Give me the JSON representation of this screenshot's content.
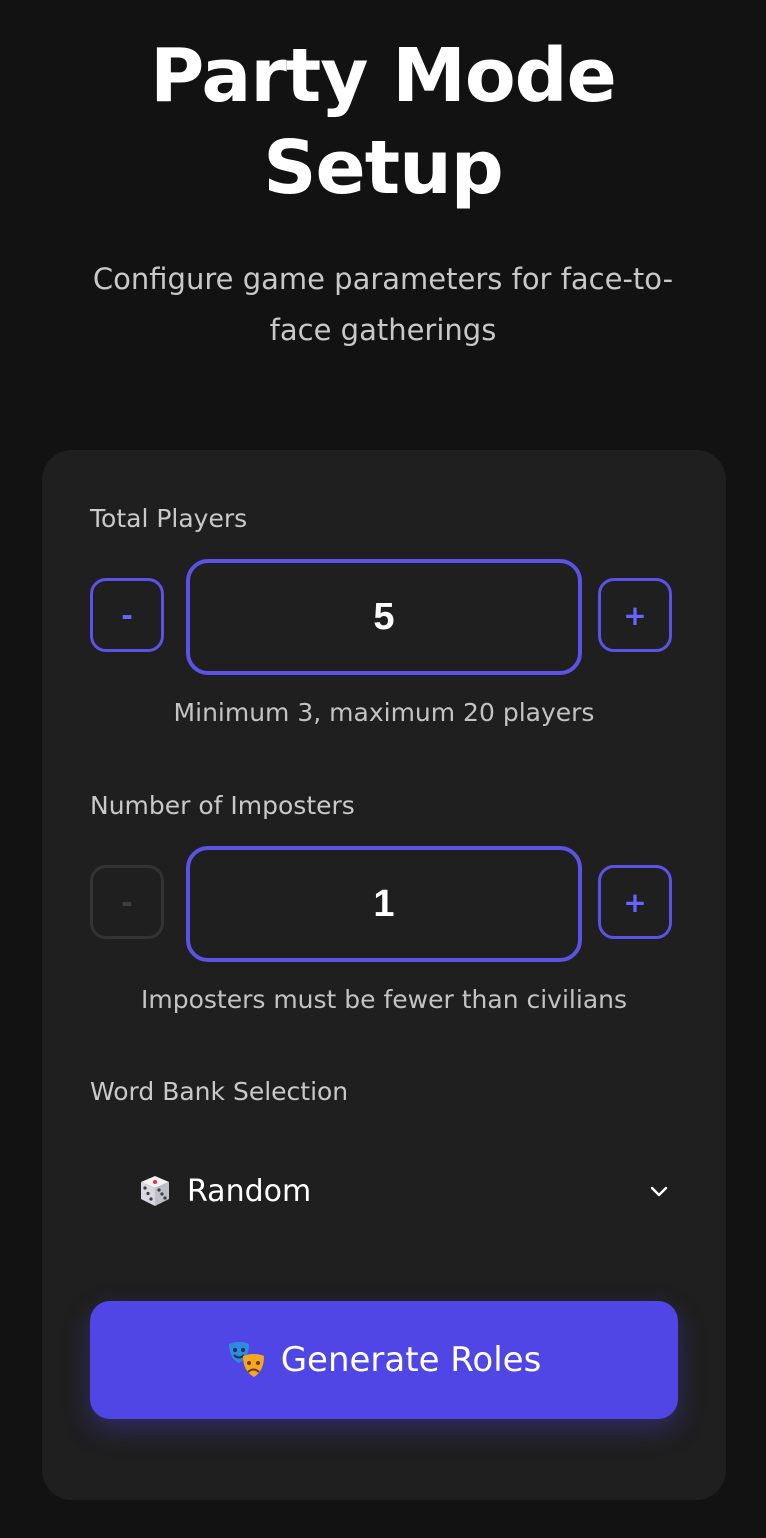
{
  "header": {
    "title_line1": "Party Mode",
    "title_line2": "Setup",
    "subtitle_line1": "Configure game parameters for face-to-",
    "subtitle_line2": "face gatherings"
  },
  "players": {
    "label": "Total Players",
    "decrement_label": "-",
    "increment_label": "+",
    "value": "5",
    "hint": "Minimum 3, maximum 20 players"
  },
  "imposters": {
    "label": "Number of Imposters",
    "decrement_label": "-",
    "increment_label": "+",
    "value": "1",
    "hint": "Imposters must be fewer than civilians",
    "decrement_disabled": true
  },
  "word_bank": {
    "label": "Word Bank Selection",
    "selected": "Random",
    "selected_icon": "dice-icon"
  },
  "generate_button": {
    "label": "Generate Roles",
    "icon": "theater-masks-icon"
  },
  "colors": {
    "background": "#121212",
    "card": "#1f1f1f",
    "accent": "#4f46e5",
    "accent_border": "#5b52e6",
    "muted_text": "#c9c9c9"
  }
}
